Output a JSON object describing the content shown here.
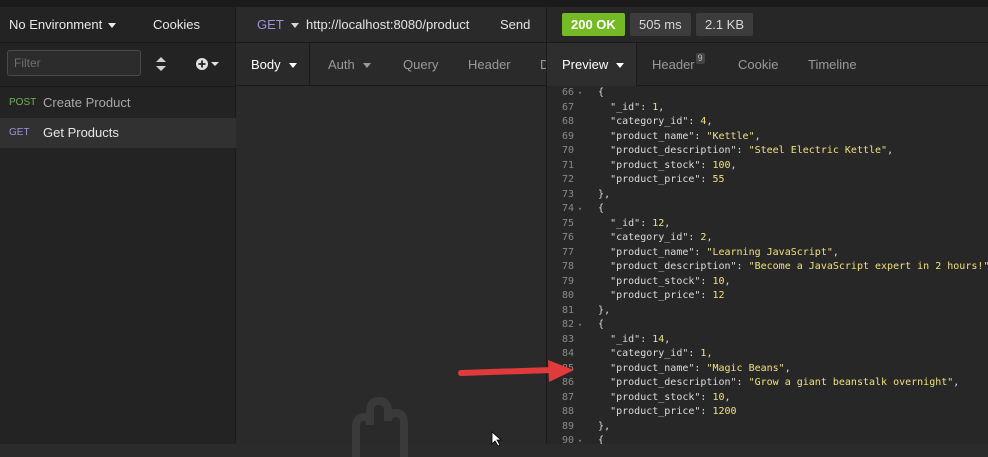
{
  "sidebar": {
    "environment_label": "No Environment",
    "cookies_label": "Cookies",
    "filter_placeholder": "Filter",
    "requests": [
      {
        "method": "POST",
        "name": "Create Product"
      },
      {
        "method": "GET",
        "name": "Get Products"
      }
    ]
  },
  "request": {
    "method": "GET",
    "url": "http://localhost:8080/product",
    "send_label": "Send",
    "tabs": [
      "Body",
      "Auth",
      "Query",
      "Header",
      "D"
    ]
  },
  "response": {
    "status": "200 OK",
    "time": "505 ms",
    "size": "2.1 KB",
    "tabs": [
      "Preview",
      "Header",
      "Cookie",
      "Timeline"
    ],
    "header_count": "9",
    "lines": [
      {
        "n": "66",
        "fold": true,
        "text": "{"
      },
      {
        "n": "67",
        "key": "\"_id\"",
        "val": "1",
        "type": "num",
        "comma": ","
      },
      {
        "n": "68",
        "key": "\"category_id\"",
        "val": "4",
        "type": "num",
        "comma": ","
      },
      {
        "n": "69",
        "key": "\"product_name\"",
        "val": "\"Kettle\"",
        "type": "str",
        "comma": ","
      },
      {
        "n": "70",
        "key": "\"product_description\"",
        "val": "\"Steel Electric Kettle\"",
        "type": "str",
        "comma": ","
      },
      {
        "n": "71",
        "key": "\"product_stock\"",
        "val": "100",
        "type": "num",
        "comma": ","
      },
      {
        "n": "72",
        "key": "\"product_price\"",
        "val": "55",
        "type": "num",
        "comma": ""
      },
      {
        "n": "73",
        "text": "},"
      },
      {
        "n": "74",
        "fold": true,
        "text": "{"
      },
      {
        "n": "75",
        "key": "\"_id\"",
        "val": "12",
        "type": "num",
        "comma": ","
      },
      {
        "n": "76",
        "key": "\"category_id\"",
        "val": "2",
        "type": "num",
        "comma": ","
      },
      {
        "n": "77",
        "key": "\"product_name\"",
        "val": "\"Learning JavaScript\"",
        "type": "str",
        "comma": ","
      },
      {
        "n": "78",
        "key": "\"product_description\"",
        "val": "\"Become a JavaScript expert in 2 hours!\"",
        "type": "str",
        "comma": ","
      },
      {
        "n": "79",
        "key": "\"product_stock\"",
        "val": "10",
        "type": "num",
        "comma": ","
      },
      {
        "n": "80",
        "key": "\"product_price\"",
        "val": "12",
        "type": "num",
        "comma": ""
      },
      {
        "n": "81",
        "text": "},"
      },
      {
        "n": "82",
        "fold": true,
        "text": "{"
      },
      {
        "n": "83",
        "key": "\"_id\"",
        "val": "14",
        "type": "num",
        "comma": ","
      },
      {
        "n": "84",
        "key": "\"category_id\"",
        "val": "1",
        "type": "num",
        "comma": ","
      },
      {
        "n": "85",
        "key": "\"product_name\"",
        "val": "\"Magic Beans\"",
        "type": "str",
        "comma": ","
      },
      {
        "n": "86",
        "key": "\"product_description\"",
        "val": "\"Grow a giant beanstalk overnight\"",
        "type": "str",
        "comma": ","
      },
      {
        "n": "87",
        "key": "\"product_stock\"",
        "val": "10",
        "type": "num",
        "comma": ","
      },
      {
        "n": "88",
        "key": "\"product_price\"",
        "val": "1200",
        "type": "num",
        "comma": ""
      },
      {
        "n": "89",
        "text": "},"
      },
      {
        "n": "90",
        "fold": true,
        "text": "{"
      }
    ]
  },
  "colors": {
    "accent_ok": "#75ba24",
    "method_get": "#9b94d6",
    "method_post": "#6fb35a",
    "value": "#f2e07a",
    "arrow": "#e03a3a"
  }
}
